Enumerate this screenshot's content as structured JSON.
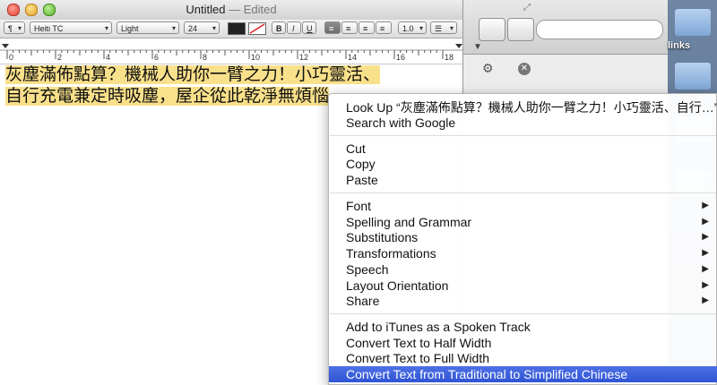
{
  "window": {
    "title": "Untitled",
    "edited_suffix": "— Edited"
  },
  "formatbar": {
    "paragraph_label": "¶",
    "font_family": "Heiti TC",
    "font_style": "Light",
    "font_size": "24",
    "bold": "B",
    "italic": "I",
    "underline": "U",
    "line_spacing": "1.0"
  },
  "ruler": {
    "numbers": [
      "0",
      "2",
      "4",
      "6",
      "8",
      "10",
      "12",
      "14",
      "16",
      "18"
    ]
  },
  "document": {
    "line1": "灰塵滿佈點算？機械人助你一臂之力！小巧靈活、",
    "line2": "自行充電兼定時吸塵，屋企從此乾淨無煩惱"
  },
  "background": {
    "folder_label": "links"
  },
  "menu": {
    "look_up": "Look Up “灰塵滿佈點算？機械人助你一臂之力！小巧靈活、自行…”",
    "search_google": "Search with Google",
    "cut": "Cut",
    "copy": "Copy",
    "paste": "Paste",
    "font": "Font",
    "spelling": "Spelling and Grammar",
    "substitutions": "Substitutions",
    "transformations": "Transformations",
    "speech": "Speech",
    "layout_orientation": "Layout Orientation",
    "share": "Share",
    "itunes": "Add to iTunes as a Spoken Track",
    "half_width": "Convert Text to Half Width",
    "full_width": "Convert Text to Full Width",
    "convert_chinese": "Convert Text from Traditional to Simplified Chinese",
    "submenu_arrow": "▶"
  },
  "colors": {
    "highlight": "#f9e08a",
    "menu_selection": "#3b62de"
  }
}
